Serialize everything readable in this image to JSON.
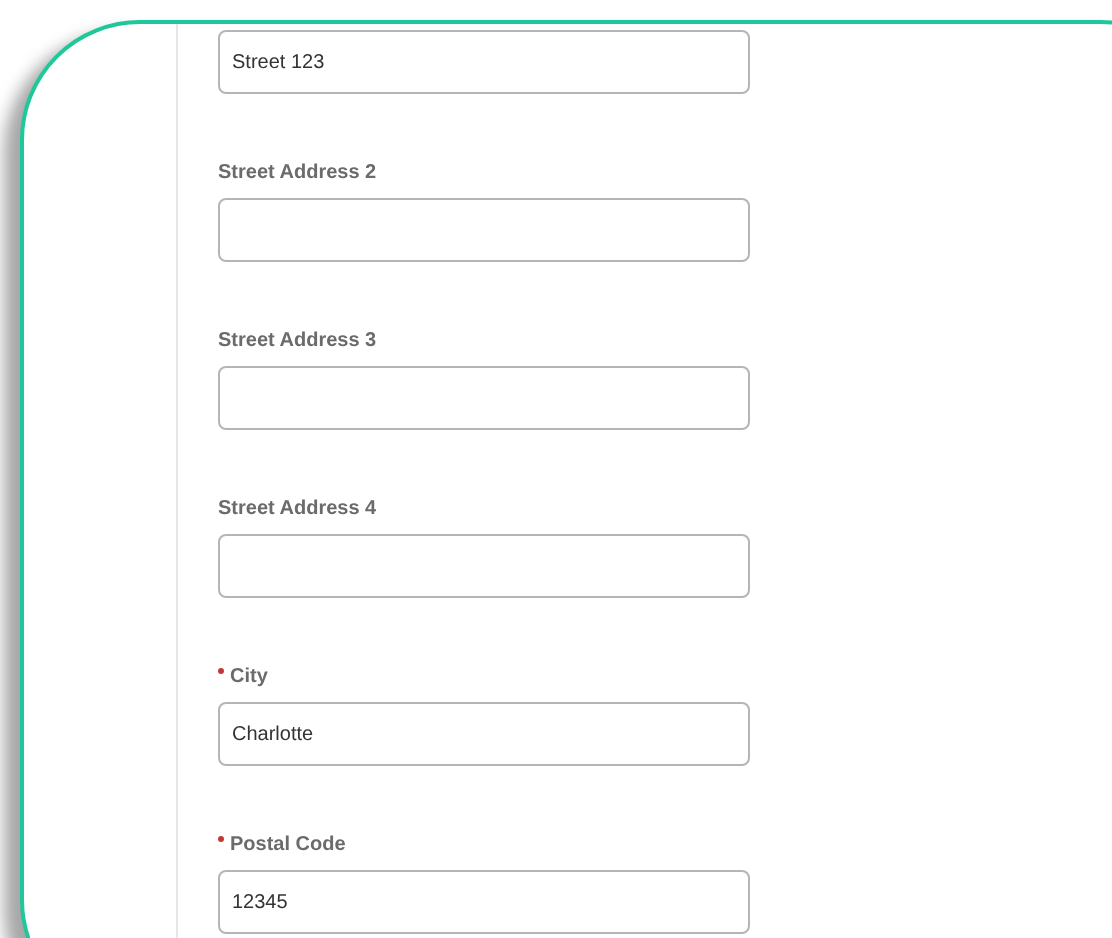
{
  "fields": [
    {
      "value": "Street 123"
    },
    {
      "label": "Street Address 2",
      "required": false
    },
    {
      "label": "Street Address 3",
      "required": false
    },
    {
      "label": "Street Address 4",
      "required": false
    },
    {
      "label": "City",
      "value": "Charlotte",
      "required": true
    },
    {
      "label": "Postal Code",
      "value": "12345",
      "required": true
    }
  ]
}
